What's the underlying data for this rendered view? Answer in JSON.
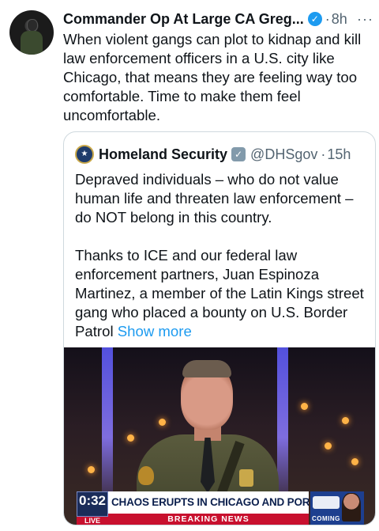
{
  "post": {
    "author": "Commander Op At Large CA Greg...",
    "time_separator": "·",
    "time": "8h",
    "more_glyph": "···",
    "text": "When violent gangs can plot to kidnap and kill law enforcement officers in a U.S. city like Chicago, that means they are feeling way too comfortable. Time to make them feel uncomfortable."
  },
  "quote": {
    "author": "Homeland Security",
    "handle": "@DHSgov",
    "time_separator": "·",
    "time": "15h",
    "text": "Depraved individuals – who do not value human life and threaten law enforcement – do NOT belong in this country.\n\nThanks to ICE and our federal law enforcement partners, Juan Espinoza Martinez, a member of the Latin Kings street gang who placed a bounty on U.S. Border Patrol",
    "show_more": "Show more"
  },
  "media": {
    "clock": "0:32",
    "live": "LIVE",
    "headline": "CHAOS ERUPTS IN CHICAGO AND PORTLAND",
    "breaking": "BREAKING NEWS",
    "promo_coming": "COMING"
  },
  "colors": {
    "verified_blue": "#1d9bf0",
    "verified_gray": "#829aab",
    "link": "#1d9bf0",
    "muted": "#536471"
  }
}
